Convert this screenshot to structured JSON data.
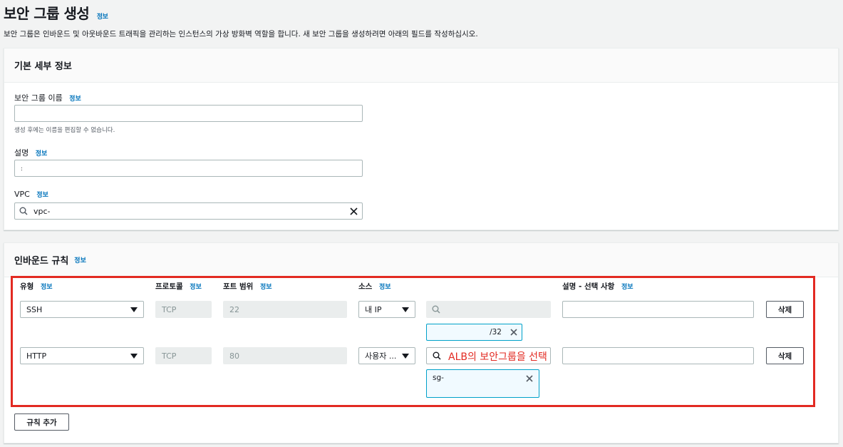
{
  "header": {
    "title": "보안 그룹 생성",
    "info_link": "정보",
    "description": "보안 그룹은 인바운드 및 아웃바운드 트래픽을 관리하는 인스턴스의 가상 방화벽 역할을 합니다. 새 보안 그룹을 생성하려면 아래의 필드를 작성하십시오."
  },
  "basic_details": {
    "title": "기본 세부 정보",
    "name_label": "보안 그룹 이름",
    "name_info": "정보",
    "name_value": "",
    "name_hint": "생성 후에는 이름을 편집할 수 없습니다.",
    "desc_label": "설명",
    "desc_info": "정보",
    "desc_value": ":",
    "vpc_label": "VPC",
    "vpc_info": "정보",
    "vpc_value": "vpc-"
  },
  "inbound": {
    "title": "인바운드 규칙",
    "info": "정보",
    "columns": {
      "type": "유형",
      "protocol": "프로토콜",
      "port_range": "포트 범위",
      "source": "소스",
      "description": "설명 - 선택 사항",
      "info": "정보"
    },
    "rules": [
      {
        "type": "SSH",
        "protocol": "TCP",
        "port": "22",
        "source": "내 IP",
        "search_value": "",
        "token": "/32",
        "delete": "삭제"
      },
      {
        "type": "HTTP",
        "protocol": "TCP",
        "port": "80",
        "source": "사용자 ...",
        "search_value": "",
        "token": "sg-",
        "delete": "삭제"
      }
    ],
    "annotation": "ALB의 보안그룹을 선택",
    "add_rule": "규칙 추가"
  },
  "colors": {
    "info_link": "#0073bb",
    "highlight": "#e22a22",
    "token_border": "#00a1c9"
  }
}
